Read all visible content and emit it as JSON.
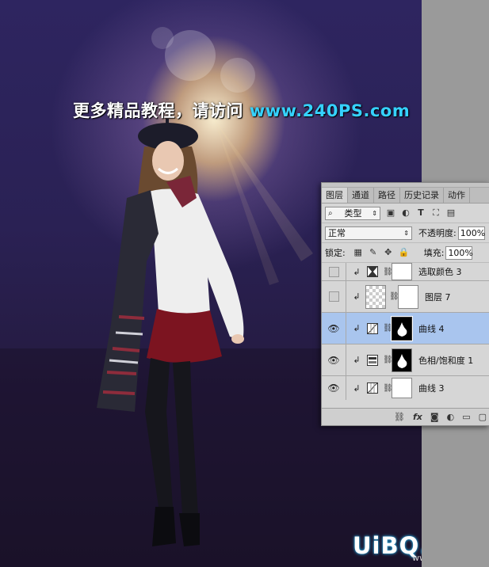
{
  "watermark": {
    "text_cn": "更多精品教程，请访问 ",
    "url": "www.240PS.com"
  },
  "logo": {
    "brand": "UiBQ.CoM",
    "site": "www.psahz.com"
  },
  "layers_panel": {
    "tabs": [
      {
        "label": "图层",
        "active": true
      },
      {
        "label": "通道",
        "active": false
      },
      {
        "label": "路径",
        "active": false
      },
      {
        "label": "历史记录",
        "active": false
      },
      {
        "label": "动作",
        "active": false
      }
    ],
    "filter": {
      "label": "类型",
      "icon": "search-icon"
    },
    "blend_mode": "正常",
    "opacity_label": "不透明度:",
    "opacity_value": "100%",
    "lock_label": "锁定:",
    "fill_label": "填充:",
    "fill_value": "100%",
    "layers": [
      {
        "name": "选取颜色 3",
        "visible": false,
        "clipped": true,
        "type": "selective-color",
        "mask": "white",
        "selected": false
      },
      {
        "name": "图层 7",
        "visible": false,
        "clipped": true,
        "type": "pixel",
        "mask": "white",
        "selected": false
      },
      {
        "name": "曲线 4",
        "visible": true,
        "clipped": true,
        "type": "curves",
        "mask": "black-figure",
        "selected": true
      },
      {
        "name": "色相/饱和度 1",
        "visible": true,
        "clipped": true,
        "type": "hue-saturation",
        "mask": "black-figure",
        "selected": false
      },
      {
        "name": "曲线 3",
        "visible": true,
        "clipped": true,
        "type": "curves",
        "mask": "white",
        "selected": false
      }
    ],
    "bottom_icons": [
      "link-icon",
      "fx-icon",
      "add-mask-icon",
      "adjustment-icon",
      "group-folder-icon",
      "new-layer-icon"
    ],
    "fx_label": "fx"
  }
}
